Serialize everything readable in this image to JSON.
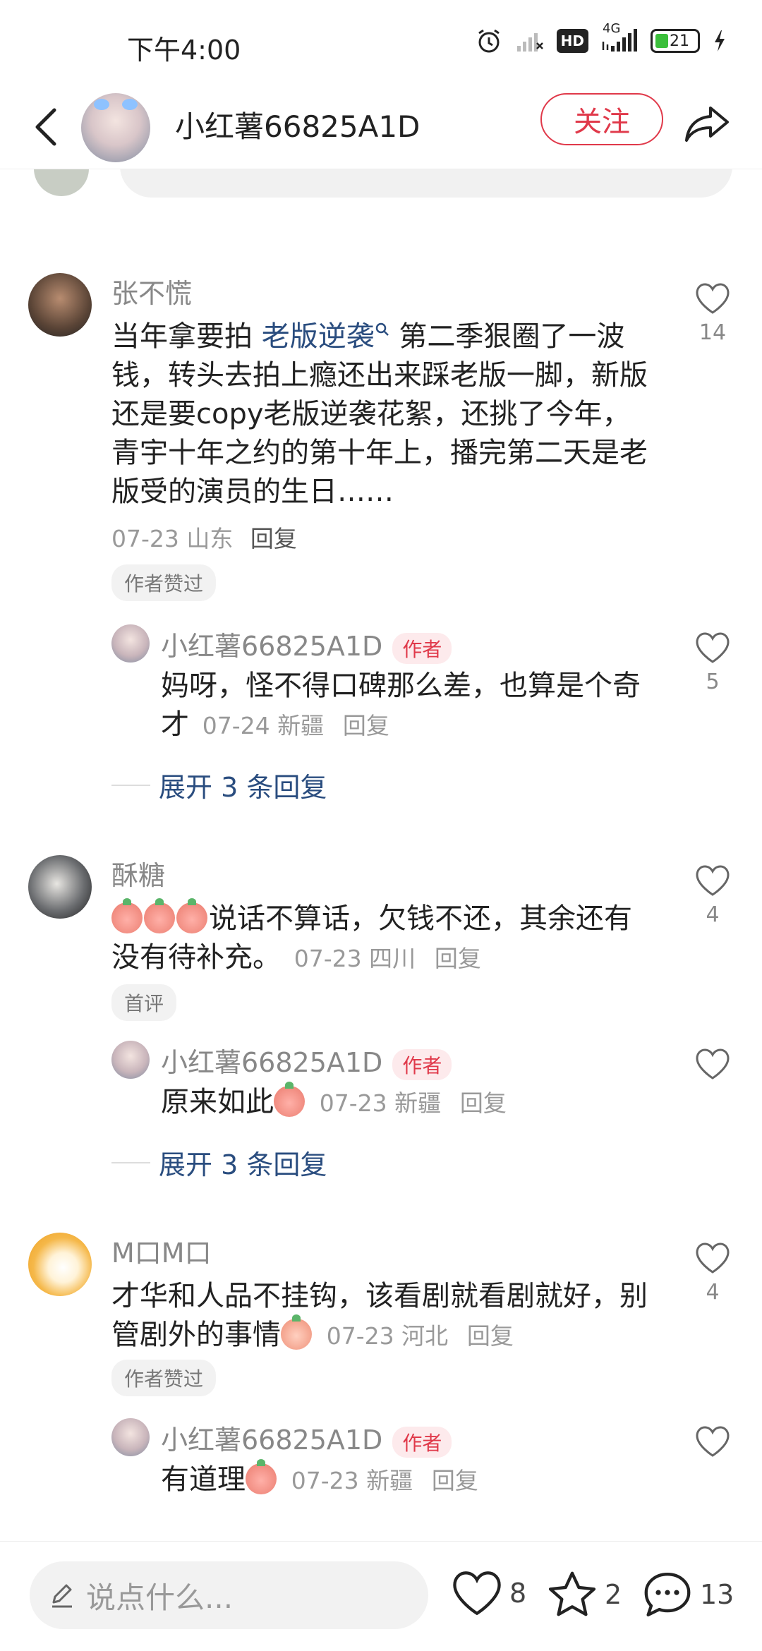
{
  "status_bar": {
    "time": "下午4:00",
    "network": "4G",
    "hd": "HD",
    "battery": "21"
  },
  "header": {
    "username": "小红薯66825A1D",
    "follow_label": "关注"
  },
  "comments": [
    {
      "user": "张不慌",
      "text_before": "当年拿要拍 ",
      "link": "老版逆袭",
      "text_after": " 第二季狠圈了一波钱，转头去拍上瘾还出来踩老版一脚，新版还是要copy老版逆袭花絮，还挑了今年，青宇十年之约的第十年上，播完第二天是老版受的演员的生日……",
      "meta": "07-23 山东",
      "reply": "回复",
      "badge": "作者赞过",
      "likes": "14",
      "sub": {
        "user": "小红薯66825A1D",
        "tag": "作者",
        "text": "妈呀，怪不得口碑那么差，也算是个奇才",
        "meta": "07-24 新疆",
        "reply": "回复",
        "likes": "5"
      },
      "expand": "展开 3 条回复"
    },
    {
      "user": "酥糖",
      "text": "说话不算话，欠钱不还，其余还有没有待补充。",
      "meta": "07-23 四川",
      "reply": "回复",
      "badge": "首评",
      "likes": "4",
      "sub": {
        "user": "小红薯66825A1D",
        "tag": "作者",
        "text": "原来如此",
        "meta": "07-23 新疆",
        "reply": "回复",
        "likes": ""
      },
      "expand": "展开 3 条回复"
    },
    {
      "user": "M口M口",
      "text": "才华和人品不挂钩，该看剧就看剧就好，别管剧外的事情",
      "meta": "07-23 河北",
      "reply": "回复",
      "badge": "作者赞过",
      "likes": "4",
      "sub": {
        "user": "小红薯66825A1D",
        "tag": "作者",
        "text": "有道理",
        "meta": "07-23 新疆",
        "reply": "回复",
        "likes": ""
      }
    }
  ],
  "bottom_bar": {
    "placeholder": "说点什么...",
    "like_count": "8",
    "star_count": "2",
    "comment_count": "13"
  }
}
